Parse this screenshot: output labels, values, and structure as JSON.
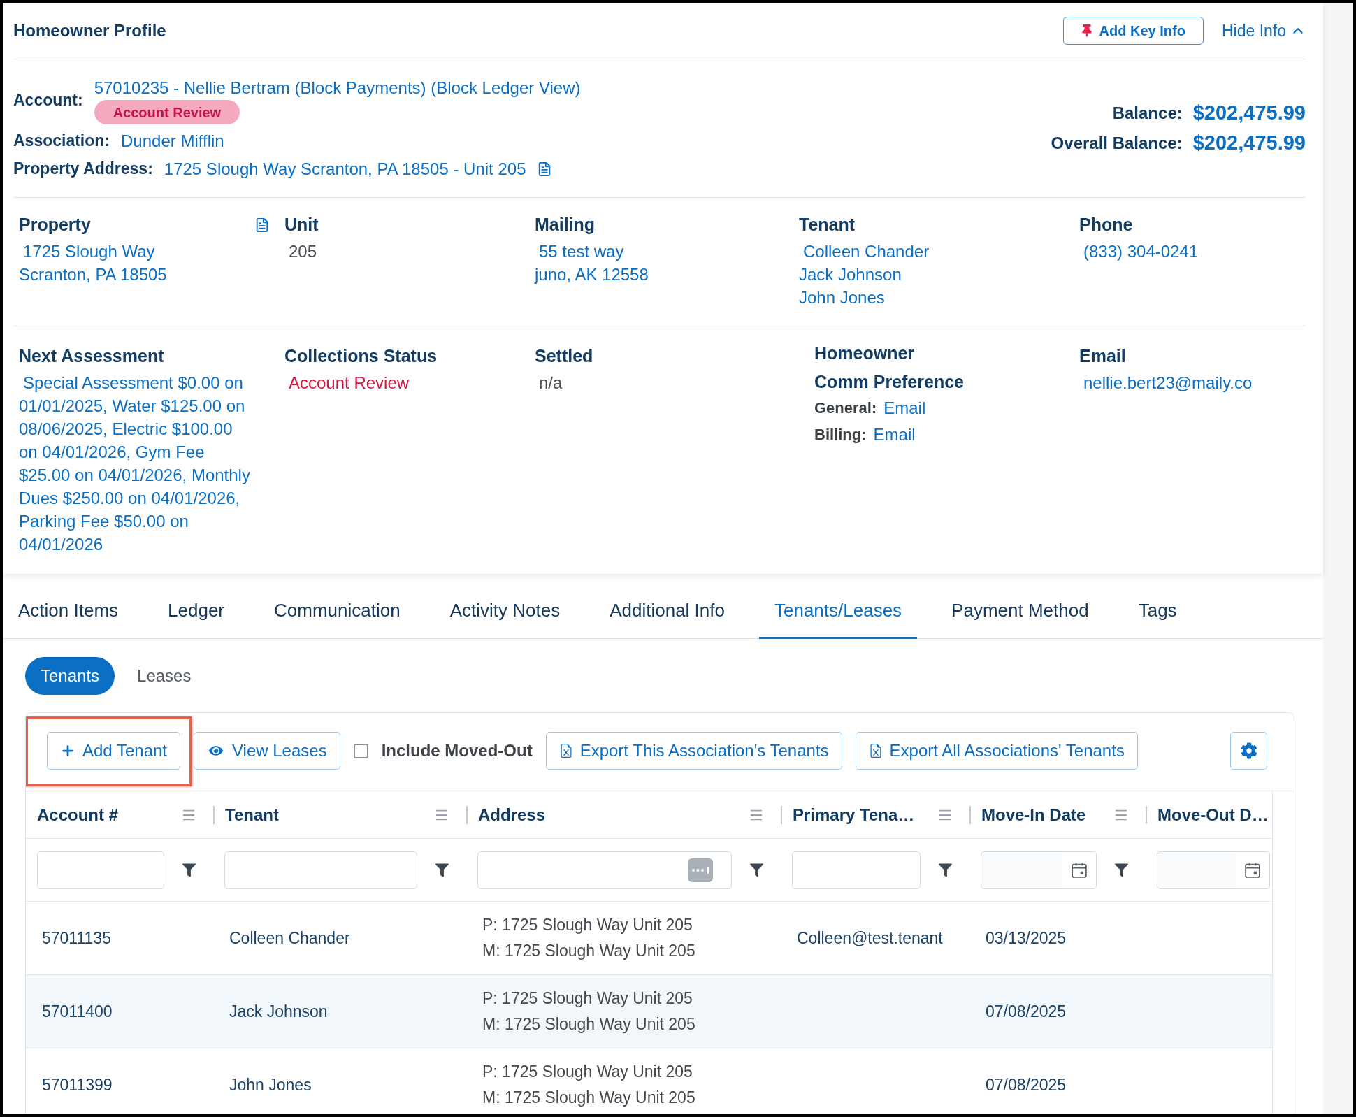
{
  "profile": {
    "title": "Homeowner Profile",
    "actions": [
      {
        "kind": "key_info",
        "label": "Add Key Info"
      },
      {
        "kind": "hide_info",
        "label": "Hide Info"
      }
    ]
  },
  "summary": {
    "fields": [
      {
        "label": "Account:",
        "value": "57010235 - Nellie Bertram (Block Payments) (Block Ledger View)",
        "badge": "Account Review",
        "document_icon": false
      },
      {
        "label": "Association:",
        "value": "Dunder Mifflin",
        "document_icon": false
      },
      {
        "label": "Property Address:",
        "value": "1725 Slough Way Scranton, PA 18505 - Unit 205",
        "document_icon": true
      }
    ],
    "balances": [
      {
        "label": "Balance:",
        "value": "$202,475.99"
      },
      {
        "label": "Overall Balance:",
        "value": "$202,475.99"
      }
    ]
  },
  "details": [
    [
      {
        "kind": "link",
        "heading": "Property",
        "document_icon": true,
        "lines": [
          "1725 Slough Way",
          "Scranton, PA 18505"
        ]
      },
      {
        "kind": "plain",
        "heading": "Unit",
        "document_icon": false,
        "lines": [
          "205"
        ]
      },
      {
        "kind": "link",
        "heading": "Mailing",
        "document_icon": false,
        "lines": [
          "55 test way",
          "juno, AK 12558"
        ]
      },
      {
        "kind": "link",
        "heading": "Tenant",
        "document_icon": false,
        "lines": [
          "Colleen Chander",
          "Jack Johnson",
          "John Jones"
        ]
      },
      {
        "kind": "link",
        "heading": "Phone",
        "document_icon": false,
        "lines": [
          "(833) 304-0241"
        ]
      }
    ],
    [
      {
        "kind": "paragraph",
        "heading": "Next Assessment",
        "document_icon": false,
        "text": "Special Assessment $0.00 on 01/01/2025, Water $125.00 on 08/06/2025, Electric $100.00 on 04/01/2026, Gym Fee $25.00 on 04/01/2026, Monthly Dues $250.00 on 04/01/2026, Parking Fee $50.00 on 04/01/2026"
      },
      {
        "kind": "alert",
        "heading": "Collections Status",
        "document_icon": false,
        "lines": [
          "Account Review"
        ]
      },
      {
        "kind": "plain",
        "heading": "Settled",
        "document_icon": false,
        "lines": [
          "n/a"
        ]
      },
      {
        "kind": "preferences",
        "heading": "Homeowner Comm Preference",
        "document_icon": false,
        "entries": [
          {
            "label": "General:",
            "value": "Email"
          },
          {
            "label": "Billing:",
            "value": "Email"
          }
        ]
      },
      {
        "kind": "link",
        "heading": "Email",
        "document_icon": false,
        "lines": [
          "nellie.bert23@maily.co"
        ]
      }
    ]
  ],
  "tabs": [
    {
      "label": "Action Items",
      "selected": false
    },
    {
      "label": "Ledger",
      "selected": false
    },
    {
      "label": "Communication",
      "selected": false
    },
    {
      "label": "Activity Notes",
      "selected": false
    },
    {
      "label": "Additional Info",
      "selected": false
    },
    {
      "label": "Tenants/Leases",
      "selected": true
    },
    {
      "label": "Payment Method",
      "selected": false
    },
    {
      "label": "Tags",
      "selected": false
    }
  ],
  "subtabs": [
    {
      "label": "Tenants",
      "selected": true
    },
    {
      "label": "Leases",
      "selected": false
    }
  ],
  "toolbar": {
    "items": [
      {
        "kind": "add",
        "label": "Add Tenant",
        "highlighted": true
      },
      {
        "kind": "view",
        "label": "View Leases",
        "highlighted": false
      },
      {
        "kind": "checkbox",
        "label": "Include Moved-Out",
        "checked": false
      },
      {
        "kind": "export",
        "label": "Export This Association's Tenants",
        "highlighted": false
      },
      {
        "kind": "export",
        "label": "Export All Associations' Tenants",
        "highlighted": false
      },
      {
        "kind": "settings",
        "highlighted": false
      }
    ]
  },
  "table": {
    "columns": [
      {
        "label": "Account #",
        "kind": "text",
        "menu_icon": true,
        "filter_icon": true
      },
      {
        "label": "Tenant",
        "kind": "text",
        "menu_icon": true,
        "filter_icon": true
      },
      {
        "label": "Address",
        "kind": "search",
        "menu_icon": true,
        "filter_icon": true
      },
      {
        "label": "Primary Tena…",
        "kind": "text",
        "menu_icon": true,
        "filter_icon": true
      },
      {
        "label": "Move-In Date",
        "kind": "date",
        "menu_icon": true,
        "filter_icon": true
      },
      {
        "label": "Move-Out D…",
        "kind": "date",
        "menu_icon": false,
        "filter_icon": false
      }
    ],
    "rows": [
      {
        "account": "57011135",
        "tenant": "Colleen Chander",
        "address": [
          "P: 1725 Slough Way Unit 205",
          "M: 1725 Slough Way Unit 205"
        ],
        "primary_tenant": "Colleen@test.tenant",
        "move_in": "03/13/2025"
      },
      {
        "account": "57011400",
        "tenant": "Jack Johnson",
        "address": [
          "P: 1725 Slough Way Unit 205",
          "M: 1725 Slough Way Unit 205"
        ],
        "move_in": "07/08/2025"
      },
      {
        "account": "57011399",
        "tenant": "John Jones",
        "address": [
          "P: 1725 Slough Way Unit 205",
          "M: 1725 Slough Way Unit 205"
        ],
        "move_in": "07/08/2025"
      }
    ]
  }
}
